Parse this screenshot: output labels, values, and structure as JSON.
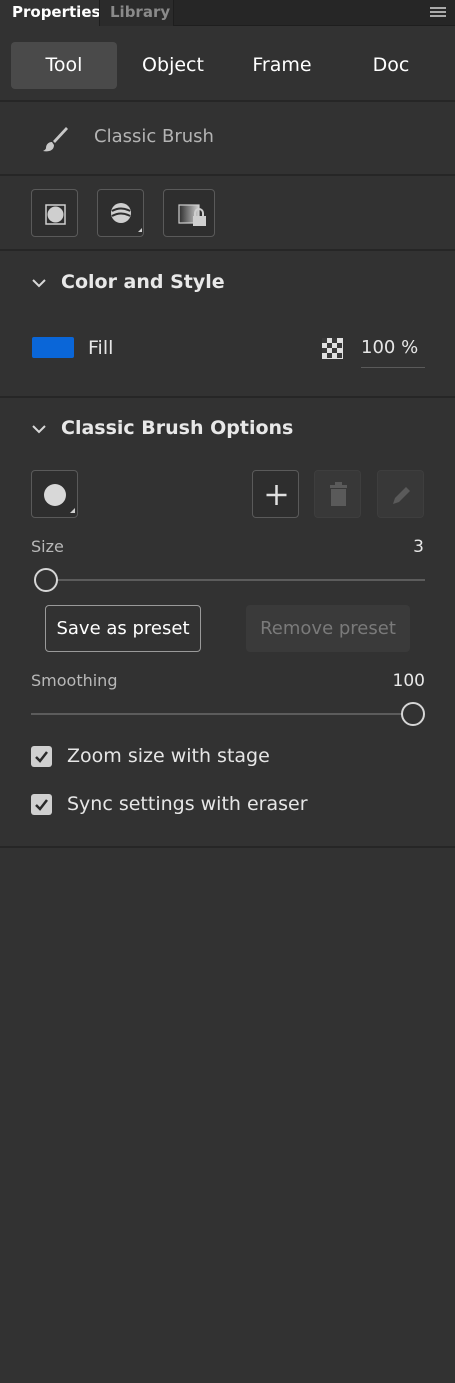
{
  "panel_tabs": [
    "Properties",
    "Library"
  ],
  "tabs": [
    "Tool",
    "Object",
    "Frame",
    "Doc"
  ],
  "selected_tab": "Tool",
  "tool": {
    "name": "Classic Brush"
  },
  "color_and_style": {
    "heading": "Color and Style",
    "fill_label": "Fill",
    "fill_color": "#0a66d8",
    "opacity": "100 %"
  },
  "brush_options": {
    "heading": "Classic Brush Options",
    "size_label": "Size",
    "size_value": "3",
    "size_fraction": 0.0,
    "save_preset": "Save as preset",
    "remove_preset": "Remove preset",
    "smoothing_label": "Smoothing",
    "smoothing_value": "100",
    "smoothing_fraction": 1.0,
    "checkboxes": [
      {
        "label": "Zoom size with stage",
        "checked": true
      },
      {
        "label": "Sync settings with eraser",
        "checked": true
      }
    ]
  }
}
